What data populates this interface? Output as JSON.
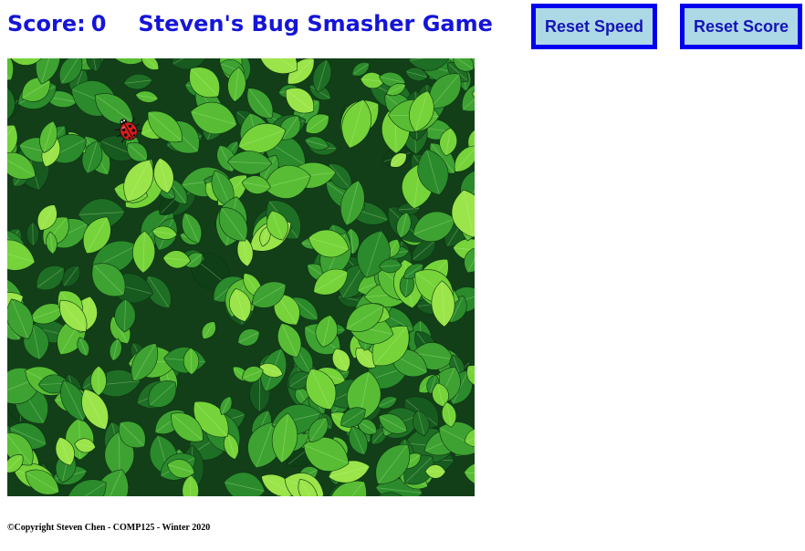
{
  "header": {
    "score_label": "Score:",
    "score_value": "0",
    "game_title": "Steven's Bug Smasher Game"
  },
  "buttons": {
    "reset_speed_label": "Reset Speed",
    "reset_score_label": "Reset Score"
  },
  "board": {
    "background": "leaf-foliage-image",
    "bug_icon": "ladybug-icon"
  },
  "footer": {
    "copyright": "©Copyright Steven Chen - COMP125 - Winter 2020"
  },
  "colors": {
    "title_text": "#1515d8",
    "button_fill": "#add8e6",
    "button_border": "#0000ee",
    "leaf_dark": "#1d5a23",
    "leaf_light": "#7ed83a",
    "ladybug_red": "#e01b1b"
  }
}
